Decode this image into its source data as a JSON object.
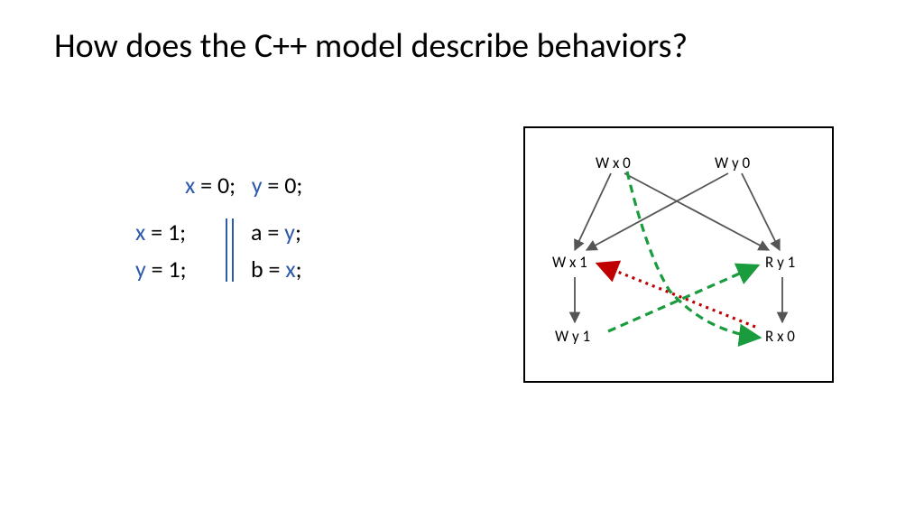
{
  "title": "How does the C++ model describe behaviors?",
  "code": {
    "init_x": "x",
    "init_x_rest": " = 0;",
    "init_y": "y",
    "init_y_rest": " = 0;",
    "t1_l1_var": "x",
    "t1_l1_rest": " = 1;",
    "t1_l2_var": "y",
    "t1_l2_rest": " = 1;",
    "t2_l1_a": "a = ",
    "t2_l1_var": "y",
    "t2_l1_semi": ";",
    "t2_l2_a": "b = ",
    "t2_l2_var": "x",
    "t2_l2_semi": ";"
  },
  "nodes": {
    "wx0": "W x 0",
    "wy0": "W y 0",
    "wx1": "W x 1",
    "ry1": "R y 1",
    "wy1": "W y 1",
    "rx0": "R x 0"
  }
}
